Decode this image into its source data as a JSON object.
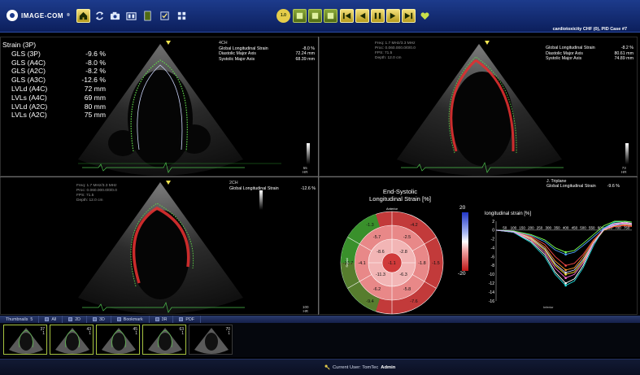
{
  "app": {
    "logo_text": "IMAGE-COM",
    "logo_mark": "®",
    "case_label": "cardiotoxicity CHF (0), PID Case #7",
    "toolbar_icons": [
      "home-icon",
      "sync-icon",
      "camera-icon",
      "layout-icon",
      "document-icon",
      "checklist-icon",
      "grid-icon",
      "speed-icon",
      "frame-icon",
      "first-frame-icon",
      "previous-frame-icon",
      "play-pause-icon",
      "next-frame-icon",
      "last-frame-icon",
      "heart-icon"
    ],
    "speed_badge": "1.0",
    "colors": {
      "toolbar": "#1d3b8c",
      "accent_gold": "#e5cd4a",
      "accent_olive": "#7a9a2c",
      "active_border": "#a6c23d"
    }
  },
  "strain_panel": {
    "title": "Strain (3P)",
    "rows": [
      {
        "label": "GLS (3P)",
        "value": "-9.6 %"
      },
      {
        "label": "GLS (A4C)",
        "value": "-8.0 %"
      },
      {
        "label": "GLS (A2C)",
        "value": "-8.2 %"
      },
      {
        "label": "GLS (A3C)",
        "value": "-12.6 %"
      },
      {
        "label": "LVLd (A4C)",
        "value": "72 mm"
      },
      {
        "label": "LVLs (A4C)",
        "value": "69 mm"
      },
      {
        "label": "LVLd (A2C)",
        "value": "80 mm"
      },
      {
        "label": "LVLs (A2C)",
        "value": "75 mm"
      }
    ]
  },
  "viewport1": {
    "view": "4CH",
    "measurements": [
      {
        "label": "Global Longitudinal Strain",
        "value": "-8.0 %"
      },
      {
        "label": "Diastolic Major Axis",
        "value": "72.24 mm"
      },
      {
        "label": "Systolic Major Axis",
        "value": "68.39 mm"
      }
    ],
    "scale": [
      "55",
      "HR"
    ]
  },
  "viewport2": {
    "acq": [
      "Freq: 1.7 MHz/3.3 MHz",
      "Proc: 0.060.000.0/0/0.0",
      "FPS: 71.5",
      "Depth: 12.0 cm"
    ],
    "measurements": [
      {
        "label": "Global Longitudinal Strain",
        "value": "-8.2 %"
      },
      {
        "label": "Diastolic Major Axis",
        "value": "80.61 mm"
      },
      {
        "label": "Systolic Major Axis",
        "value": "74.89 mm"
      }
    ],
    "scale": [
      "73",
      "HR"
    ]
  },
  "viewport3": {
    "view": "2CH",
    "acq": [
      "Freq: 1.7 MHz/3.3 MHz",
      "Proc: 0.060.000.0/0/0.0",
      "FPS: 71.5",
      "Depth: 12.0 cm"
    ],
    "measurements": [
      {
        "label": "Global Longitudinal Strain",
        "value": "-12.6 %"
      }
    ],
    "scale": [
      "100",
      "HR"
    ]
  },
  "viewport4": {
    "triplane": "J. Triplane",
    "measurements": [
      {
        "label": "Global Longitudinal Strain",
        "value": "-9.6 %"
      }
    ],
    "bullseye": {
      "title_line1": "End-Systolic",
      "title_line2": "Longitudinal Strain [%]",
      "wall_labels": {
        "top": "Anterior",
        "bottom": "Inferior",
        "left": "Septal",
        "right": "Lateral"
      },
      "values": [
        "-4.2",
        "-1.5",
        "-7.6",
        "-9.4",
        "-12.7",
        "-1.3",
        "-2.5",
        "-1.8",
        "-5.8",
        "-6.2",
        "-4.1",
        "-5.7",
        "-2.8",
        "-6.3",
        "-11.3",
        "-8.6",
        "-1.1"
      ]
    },
    "colorbar": {
      "max": "20",
      "min": "-20"
    },
    "curve_title": "longitudinal strain [%]",
    "curve_marker": "Inferior"
  },
  "chart_data": {
    "type": "line",
    "title": "longitudinal strain [%]",
    "xlabel": "",
    "ylabel": "",
    "xlim": [
      0,
      780
    ],
    "ylim": [
      -16,
      2
    ],
    "x_ticks": [
      "50",
      "100",
      "150",
      "200",
      "250",
      "300",
      "350",
      "400",
      "450",
      "500",
      "550",
      "600",
      "650",
      "700",
      "750"
    ],
    "y_ticks": [
      "2",
      "0",
      "-2",
      "-4",
      "-6",
      "-8",
      "-10",
      "-12",
      "-14",
      "-16"
    ],
    "x": [
      0,
      100,
      200,
      280,
      340,
      400,
      450,
      500,
      560,
      620,
      680,
      740,
      780
    ],
    "series": [
      {
        "color": "#ffffff",
        "values": [
          0,
          -0.5,
          -2.5,
          -5.5,
          -9.5,
          -12,
          -11,
          -8,
          -3,
          0.5,
          1.5,
          1.8,
          1.5
        ]
      },
      {
        "color": "#ffe033",
        "values": [
          0,
          -0.4,
          -2,
          -4.5,
          -8,
          -10,
          -9.5,
          -7,
          -3,
          0,
          1,
          1.5,
          1.2
        ]
      },
      {
        "color": "#ff9a2e",
        "values": [
          0,
          -0.3,
          -1.6,
          -3.8,
          -7,
          -9,
          -8.5,
          -6,
          -2.5,
          0,
          0.8,
          1.2,
          1
        ]
      },
      {
        "color": "#ff4b4b",
        "values": [
          0,
          -0.3,
          -1.4,
          -3.2,
          -6,
          -8,
          -7.5,
          -5.5,
          -2.2,
          0.2,
          0.8,
          1,
          0.8
        ]
      },
      {
        "color": "#4fa3ff",
        "values": [
          0,
          -0.2,
          -1.2,
          -2.6,
          -4.5,
          -5.5,
          -5,
          -3.5,
          -1.5,
          0.5,
          1.2,
          1.6,
          1.4
        ]
      },
      {
        "color": "#22e0e0",
        "values": [
          0,
          -0.5,
          -2.8,
          -6,
          -10,
          -12.5,
          -11.5,
          -8.5,
          -3.5,
          0.5,
          1.8,
          2,
          1.8
        ]
      },
      {
        "color": "#7dff4f",
        "values": [
          0,
          -0.2,
          -1,
          -2.2,
          -4,
          -5,
          -4.6,
          -3,
          -1,
          1,
          2,
          2,
          1.8
        ]
      },
      {
        "color": "#ff6bd6",
        "values": [
          0,
          -0.4,
          -2.2,
          -5,
          -8.6,
          -10.8,
          -10,
          -7.4,
          -3,
          0.3,
          1.4,
          1.6,
          1.4
        ]
      },
      {
        "color": "#d0d0ff",
        "values": [
          0,
          -0.3,
          -1.8,
          -4.2,
          -7.6,
          -9.6,
          -9,
          -6.6,
          -2.8,
          0.1,
          1.1,
          1.4,
          1.2
        ]
      }
    ]
  },
  "thumbnails": {
    "label": "Thumbnails",
    "count": "5",
    "tabs": [
      "All",
      "2D",
      "3D",
      "Bookmark",
      "3R",
      "PDF"
    ],
    "items": [
      {
        "num": "37\n1"
      },
      {
        "num": "43\n1"
      },
      {
        "num": "45\n1"
      },
      {
        "num": "63\n1"
      },
      {
        "num": "70\n1"
      }
    ]
  },
  "status": {
    "label": "Current User: TomTec",
    "user": "Admin"
  }
}
